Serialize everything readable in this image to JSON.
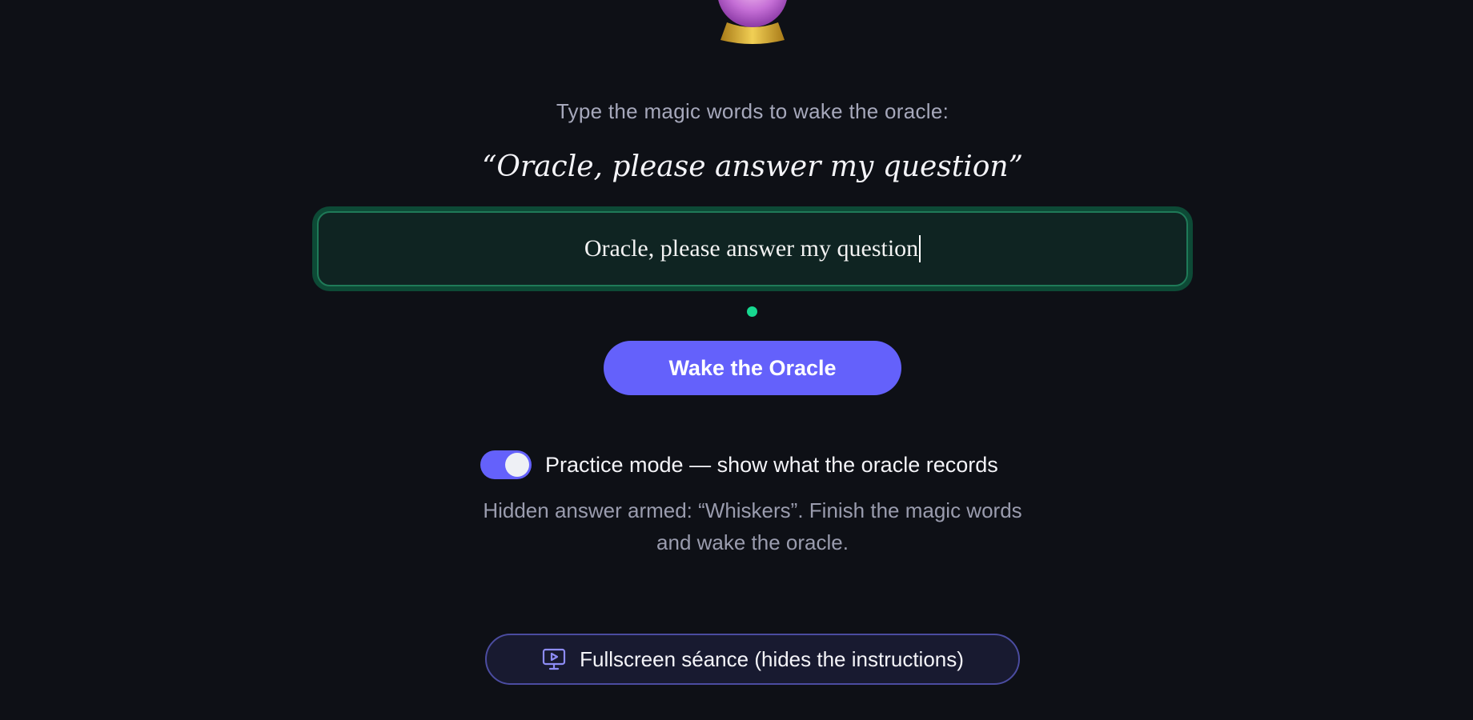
{
  "orb": {
    "icon": "crystal-ball-icon"
  },
  "instructions": {
    "prompt": "Type the magic words to wake the oracle:",
    "phrase": "“Oracle, please answer my question”"
  },
  "input": {
    "value": "Oracle, please answer my question"
  },
  "status": {
    "color": "#17d890"
  },
  "actions": {
    "wake_label": "Wake the Oracle"
  },
  "practice": {
    "enabled": true,
    "label": "Practice mode — show what the oracle records",
    "hint_line1": "Hidden answer armed: “Whiskers”. Finish the magic words",
    "hint_line2": "and wake the oracle."
  },
  "fullscreen": {
    "icon": "presentation-play-icon",
    "label": "Fullscreen séance (hides the instructions)"
  },
  "colors": {
    "accent": "#6461fb",
    "success": "#17d890",
    "background": "#0e1016"
  }
}
